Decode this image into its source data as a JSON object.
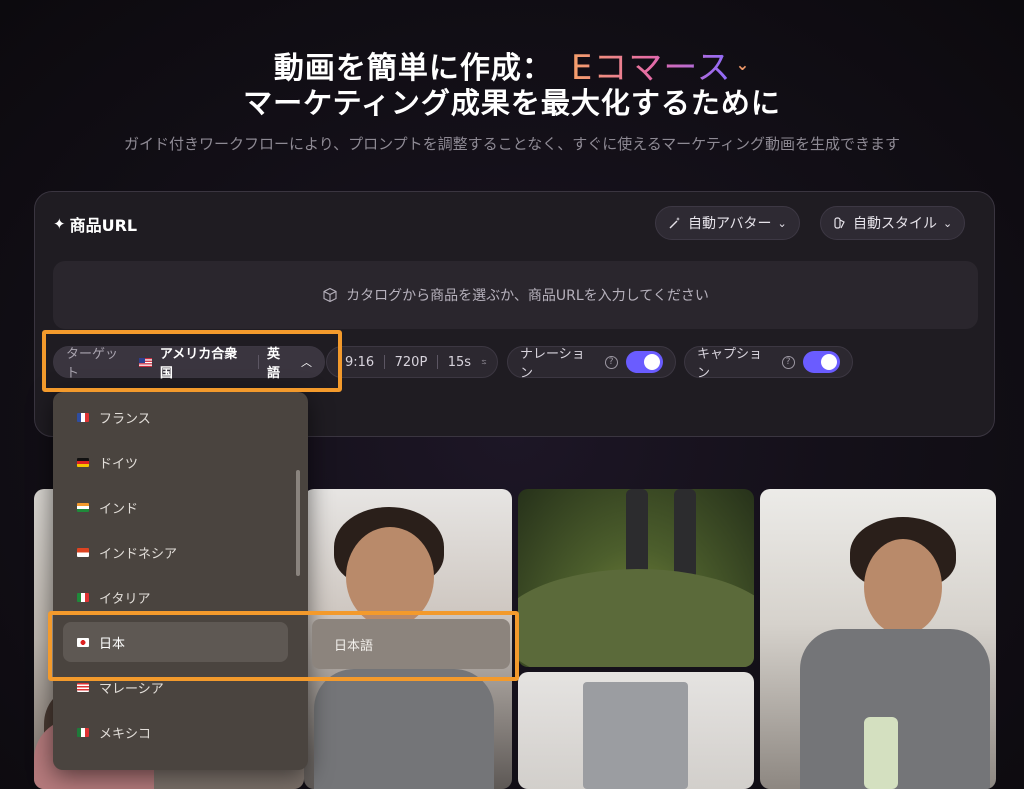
{
  "hero": {
    "title_prefix": "動画を簡単に作成：",
    "title_accent": "Eコマース",
    "title_line2": "マーケティング成果を最大化するために",
    "subtitle": "ガイド付きワークフローにより、プロンプトを調整することなく、すぐに使えるマーケティング動画を生成できます"
  },
  "card": {
    "title": "商品URL",
    "avatar_button": "自動アバター",
    "style_button": "自動スタイル",
    "url_placeholder": "カタログから商品を選ぶか、商品URLを入力してください"
  },
  "options": {
    "target_label": "ターゲット",
    "target_country": "アメリカ合衆国",
    "target_language": "英語",
    "aspect": "9:16",
    "resolution": "720P",
    "duration": "15s",
    "narration_label": "ナレーション",
    "narration_on": true,
    "caption_label": "キャプション",
    "caption_on": true
  },
  "dropdown": {
    "items": [
      {
        "label": "フランス",
        "flag": "france"
      },
      {
        "label": "ドイツ",
        "flag": "germany"
      },
      {
        "label": "インド",
        "flag": "india"
      },
      {
        "label": "インドネシア",
        "flag": "indonesia"
      },
      {
        "label": "イタリア",
        "flag": "italy"
      },
      {
        "label": "日本",
        "flag": "japan"
      },
      {
        "label": "マレーシア",
        "flag": "malaysia"
      },
      {
        "label": "メキシコ",
        "flag": "mexico"
      }
    ],
    "selected": "日本",
    "submenu_language": "日本語"
  },
  "colors": {
    "accent_orange": "#f39a2c",
    "toggle_purple": "#6a5cff",
    "card_bg": "#1f1c22",
    "dropdown_bg": "#4a443f"
  }
}
